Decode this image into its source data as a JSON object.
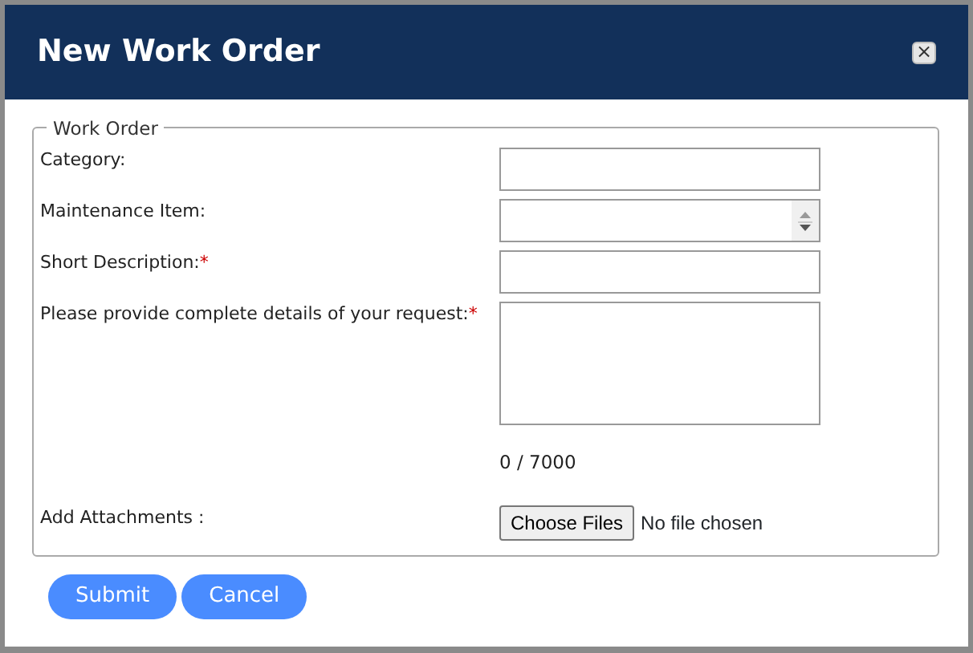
{
  "dialog": {
    "title": "New Work Order",
    "close_icon": "×"
  },
  "fieldset": {
    "legend": "Work Order",
    "fields": [
      {
        "kind": "text",
        "label": "Category:"
      },
      {
        "kind": "listbox",
        "label": "Maintenance Item:"
      },
      {
        "kind": "text",
        "label": "Short Description:",
        "required_mark": "*"
      },
      {
        "kind": "textarea",
        "label": "Please provide complete details of your request:",
        "required_mark": "*",
        "counter": "0 / 7000"
      },
      {
        "kind": "file",
        "label": "Add Attachments :",
        "button": "Choose Files",
        "status": "No file chosen"
      }
    ]
  },
  "buttons": [
    "Submit",
    "Cancel"
  ]
}
